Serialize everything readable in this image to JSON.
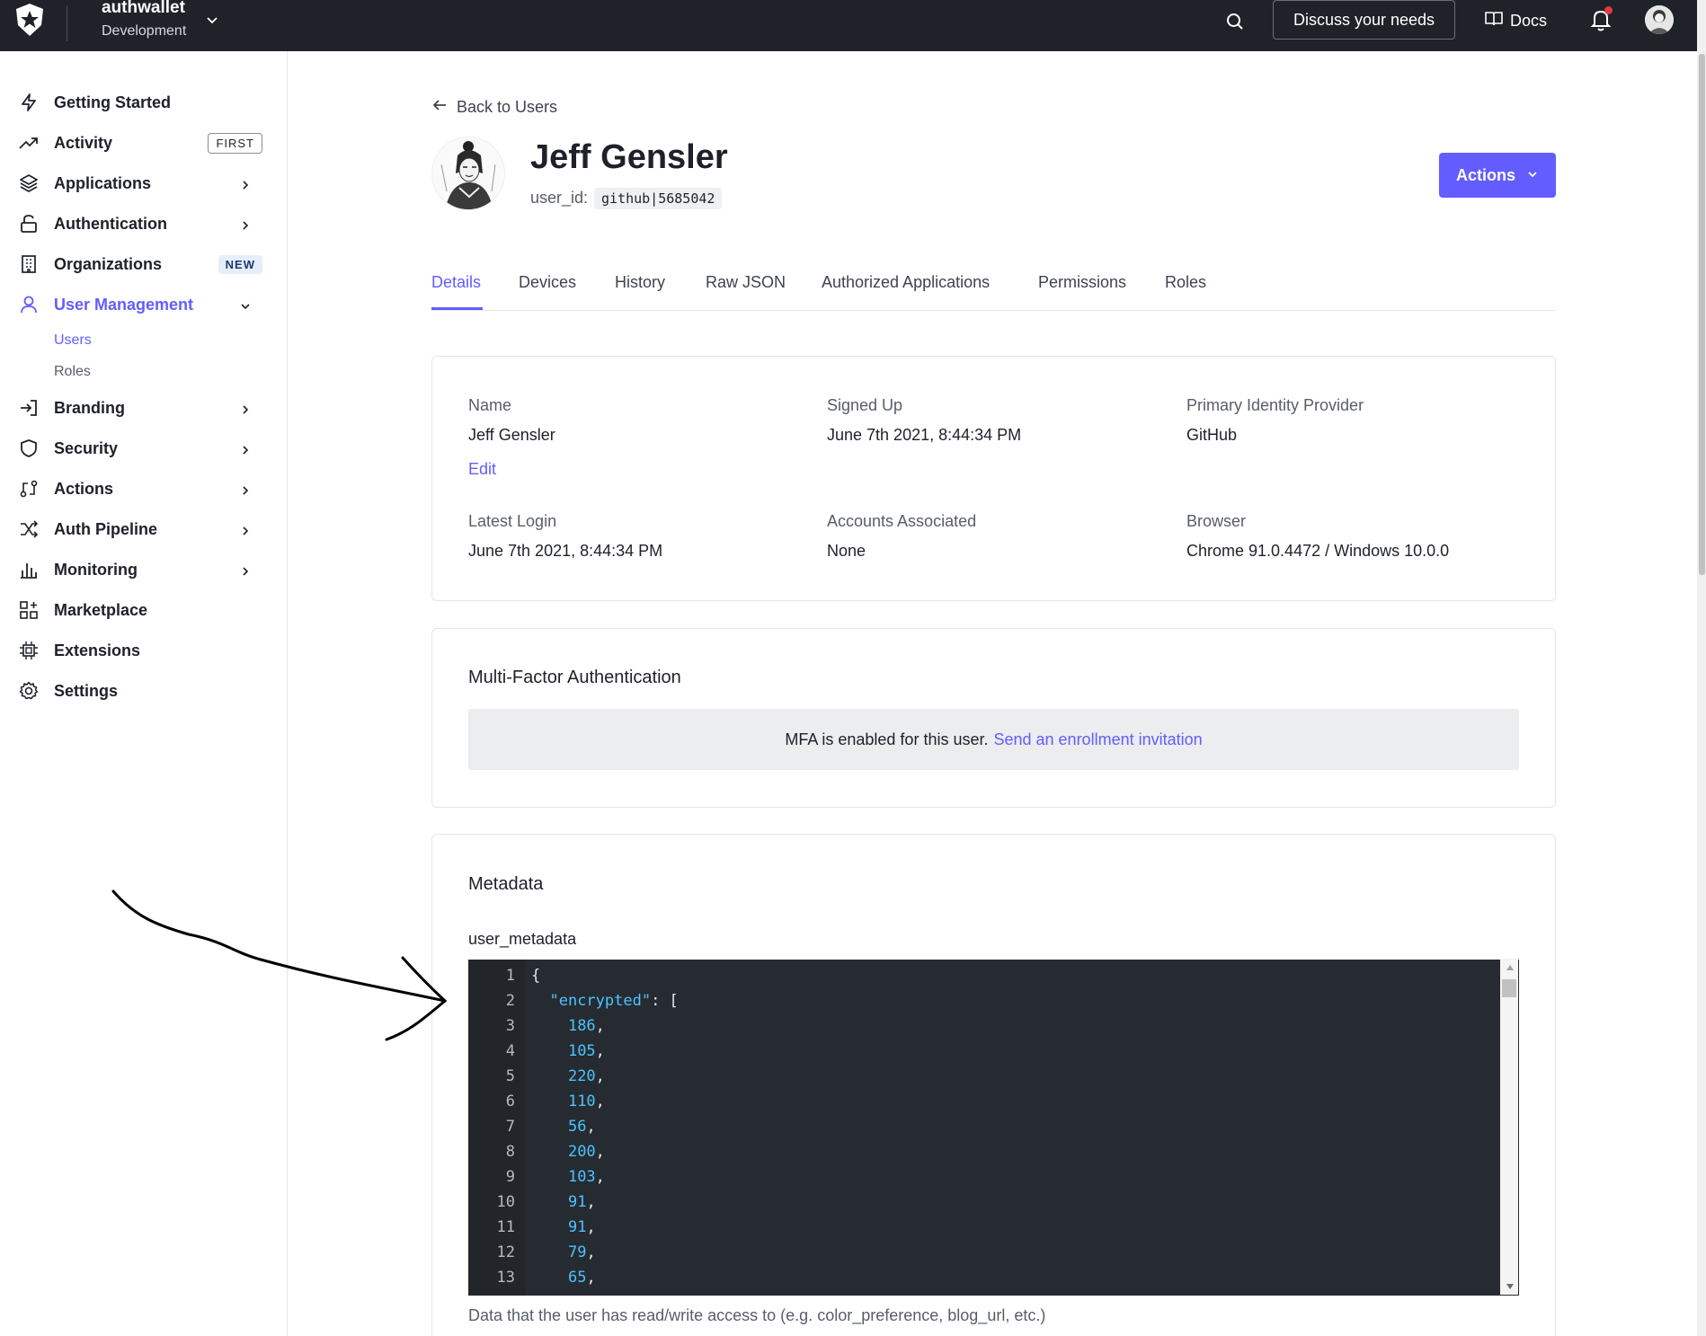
{
  "topbar": {
    "tenant_name": "authwallet",
    "tenant_env": "Development",
    "discuss_label": "Discuss your needs",
    "docs_label": "Docs",
    "icons": [
      "auth0-logo-icon",
      "chevron-down-icon",
      "search-icon",
      "book-icon",
      "bell-icon",
      "user-avatar-icon"
    ]
  },
  "sidebar": {
    "items": [
      {
        "label": "Getting Started",
        "icon": "bolt-icon"
      },
      {
        "label": "Activity",
        "icon": "trend-icon",
        "badge": "FIRST"
      },
      {
        "label": "Applications",
        "icon": "layers-icon"
      },
      {
        "label": "Authentication",
        "icon": "lock-icon"
      },
      {
        "label": "Organizations",
        "icon": "building-icon",
        "badge": "NEW"
      },
      {
        "label": "User Management",
        "icon": "user-icon"
      },
      {
        "label": "Branding",
        "icon": "login-icon"
      },
      {
        "label": "Security",
        "icon": "shield-icon"
      },
      {
        "label": "Actions",
        "icon": "actions-icon"
      },
      {
        "label": "Auth Pipeline",
        "icon": "shuffle-icon"
      },
      {
        "label": "Monitoring",
        "icon": "bar-chart-icon"
      },
      {
        "label": "Marketplace",
        "icon": "grid-plus-icon"
      },
      {
        "label": "Extensions",
        "icon": "chip-icon"
      },
      {
        "label": "Settings",
        "icon": "gear-icon"
      }
    ],
    "subitems": [
      "Users",
      "Roles"
    ]
  },
  "user": {
    "back_label": "Back to Users",
    "name": "Jeff Gensler",
    "user_id_label": "user_id:",
    "user_id": "github|5685042",
    "actions_label": "Actions"
  },
  "tabs": [
    "Details",
    "Devices",
    "History",
    "Raw JSON",
    "Authorized Applications",
    "Permissions",
    "Roles"
  ],
  "details": {
    "name_label": "Name",
    "name_value": "Jeff Gensler",
    "edit_label": "Edit",
    "signed_up_label": "Signed Up",
    "signed_up_value": "June 7th 2021, 8:44:34 PM",
    "idp_label": "Primary Identity Provider",
    "idp_value": "GitHub",
    "latest_login_label": "Latest Login",
    "latest_login_value": "June 7th 2021, 8:44:34 PM",
    "accounts_label": "Accounts Associated",
    "accounts_value": "None",
    "browser_label": "Browser",
    "browser_value": "Chrome 91.0.4472 / Windows 10.0.0"
  },
  "mfa": {
    "title": "Multi-Factor Authentication",
    "message": "MFA is enabled for this user.",
    "link": "Send an enrollment invitation"
  },
  "metadata": {
    "title": "Metadata",
    "subtitle": "user_metadata",
    "help": "Data that the user has read/write access to (e.g. color_preference, blog_url, etc.)",
    "code_lines": [
      {
        "n": "1",
        "text": "{"
      },
      {
        "n": "2",
        "key": "\"encrypted\"",
        "after": ": ["
      },
      {
        "n": "3",
        "num": "186"
      },
      {
        "n": "4",
        "num": "105"
      },
      {
        "n": "5",
        "num": "220"
      },
      {
        "n": "6",
        "num": "110"
      },
      {
        "n": "7",
        "num": "56"
      },
      {
        "n": "8",
        "num": "200"
      },
      {
        "n": "9",
        "num": "103"
      },
      {
        "n": "10",
        "num": "91"
      },
      {
        "n": "11",
        "num": "91"
      },
      {
        "n": "12",
        "num": "79"
      },
      {
        "n": "13",
        "num": "65"
      }
    ]
  },
  "colors": {
    "accent": "#635dff",
    "topbar": "#1f2229",
    "editor_bg": "#262b31",
    "code_token": "#4cc3ff"
  }
}
